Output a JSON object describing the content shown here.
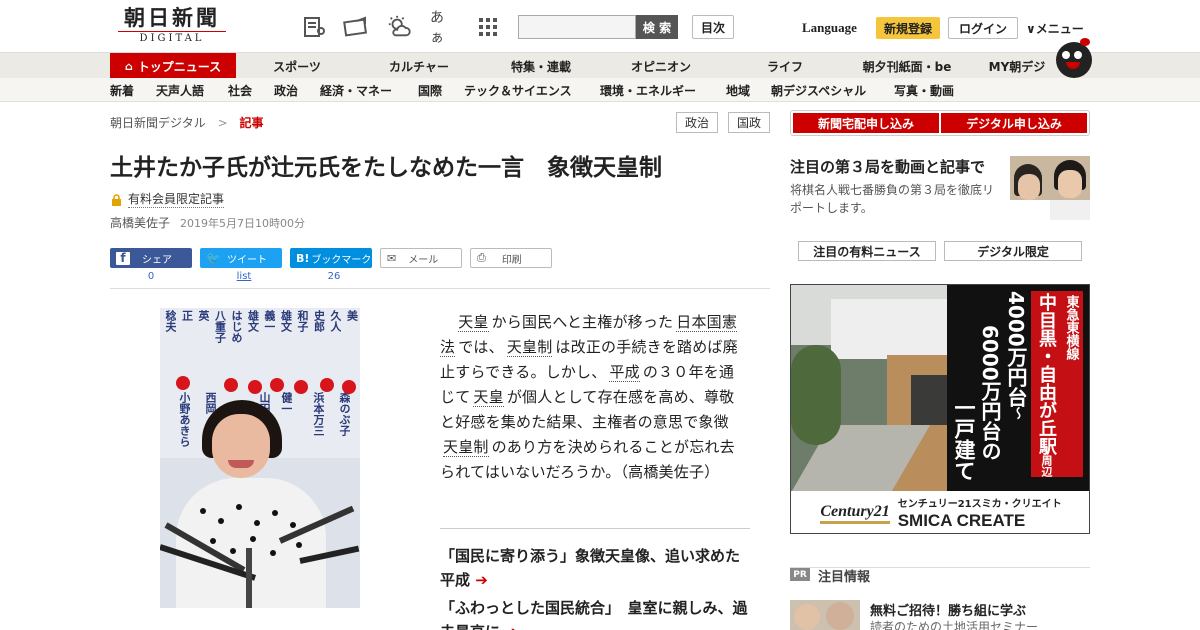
{
  "header": {
    "logo_jp": "朝日新聞",
    "logo_en": "DIGITAL",
    "search_button": "検 索",
    "contents_button": "目次",
    "language": "Language",
    "register": "新規登録",
    "login": "ログイン",
    "menu": "∨メニュー",
    "font_toggle": "あぁ"
  },
  "nav_main": [
    "トップニュース",
    "スポーツ",
    "カルチャー",
    "特集・連載",
    "オピニオン",
    "ライフ",
    "朝夕刊紙面・be",
    "MY朝デジ"
  ],
  "nav_sub": [
    "新着",
    "天声人語",
    "社会",
    "政治",
    "経済・マネー",
    "国際",
    "テック＆サイエンス",
    "環境・エネルギー",
    "地域",
    "朝デジスペシャル",
    "写真・動画"
  ],
  "breadcrumb": {
    "home": "朝日新聞デジタル",
    "sep": ">",
    "current": "記事"
  },
  "tags": [
    "政治",
    "国政"
  ],
  "article": {
    "title": "土井たか子氏が辻元氏をたしなめた一言　象徴天皇制",
    "paid_label": "有料会員限定記事",
    "author": "高橋美佐子",
    "date": "2019年5月7日10時00分",
    "body": [
      {
        "t": "　"
      },
      {
        "t": "天皇",
        "link": true
      },
      {
        "t": "から国民へと主権が移った"
      },
      {
        "t": "日本国憲法",
        "link": true
      },
      {
        "t": "では、"
      },
      {
        "t": "天皇制",
        "link": true
      },
      {
        "t": "は改正の手続きを踏めば廃止すらできる。しかし、"
      },
      {
        "t": "平成",
        "link": true
      },
      {
        "t": "の３０年を通じて"
      },
      {
        "t": "天皇",
        "link": true
      },
      {
        "t": "が個人として存在感を高め、尊敬と好感を集めた結果、主権者の意思で象徴"
      },
      {
        "t": "天皇制",
        "link": true
      },
      {
        "t": "のあり方を決められることが忘れ去られてはいないだろうか。（高橋美佐子）"
      }
    ],
    "related": [
      "「国民に寄り添う」象徴天皇像、追い求めた平成",
      "「ふわっとした国民統合」　皇室に親しみ、過去最高に"
    ],
    "related_arrow": "➔"
  },
  "share": {
    "facebook": {
      "label": "シェア",
      "count": "0"
    },
    "twitter": {
      "label": "ツイート",
      "count": "list"
    },
    "hatena": {
      "label": "ブックマーク",
      "icon": "B!",
      "count": "26"
    },
    "mail": {
      "label": "メール"
    },
    "print": {
      "label": "印刷"
    }
  },
  "photo_text": {
    "names": [
      "稔夫",
      "正",
      "英",
      "八重子",
      "はじめ",
      "雄文",
      "義一",
      "雄文",
      "和子",
      "史郎",
      "久人",
      "美"
    ],
    "names2": [
      "小野あきら",
      "西岡",
      "山田",
      "健一",
      "浜本万三",
      "森のぶ子"
    ]
  },
  "sidebar": {
    "subscribe_paper": "新聞宅配申し込み",
    "subscribe_digital": "デジタル申し込み",
    "feature_title": "注目の第３局を動画と記事で",
    "feature_desc": "将棋名人戦七番勝負の第３局を徹底リポートします。",
    "tab_paid": "注目の有料ニュース",
    "tab_digital": "デジタル限定",
    "pr_badge": "PR",
    "pr_label": "注目情報",
    "pr_title": "無料ご招待！勝ち組に学ぶ",
    "pr_desc": "読者のための土地活用セミナー"
  },
  "ad": {
    "line_red": "東急東横線",
    "line_place": "中目黒・自由が丘駅",
    "line_near": "周辺",
    "price1": "4000万円台",
    "tilde": "〜",
    "price2": "6000万円台の",
    "house": "一戸建て",
    "brand_logo": "Century21",
    "brand_jp": "センチュリー21スミカ・クリエイト",
    "brand_en": "SMICA CREATE"
  },
  "colors": {
    "accent": "#cc0000",
    "facebook": "#3b5998",
    "twitter": "#1da1f2",
    "hatena": "#008fde",
    "register": "#f5c63c"
  }
}
